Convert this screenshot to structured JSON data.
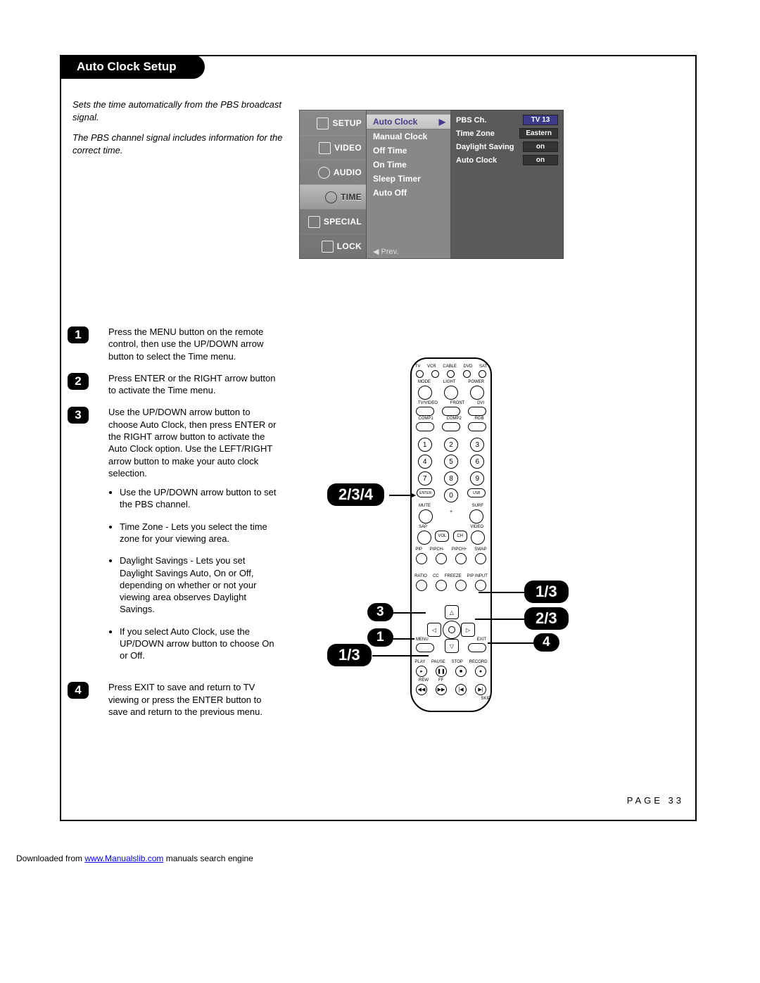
{
  "title": "Auto Clock Setup",
  "intro_p1": "Sets the time automatically from the PBS broadcast signal.",
  "intro_p2": "The PBS channel signal includes information for the correct time.",
  "osd": {
    "cats": {
      "setup": "SETUP",
      "video": "VIDEO",
      "audio": "AUDIO",
      "time": "TIME",
      "special": "SPECIAL",
      "lock": "LOCK"
    },
    "items": {
      "auto_clock": "Auto Clock",
      "manual_clock": "Manual Clock",
      "off_time": "Off Time",
      "on_time": "On Time",
      "sleep_timer": "Sleep Timer",
      "auto_off": "Auto Off"
    },
    "arrow": "▶",
    "prev": "◀ Prev.",
    "kv": {
      "pbs_k": "PBS Ch.",
      "pbs_v": "TV  13",
      "tz_k": "Time Zone",
      "tz_v": "Eastern",
      "ds_k": "Daylight Saving",
      "ds_v": "on",
      "ac_k": "Auto Clock",
      "ac_v": "on"
    }
  },
  "steps": {
    "s1": "Press the MENU button on the remote control, then use the UP/DOWN arrow button to select the Time menu.",
    "s2": "Press ENTER or the RIGHT arrow button to activate the Time menu.",
    "s3": "Use the UP/DOWN arrow button to choose Auto Clock, then press ENTER or the RIGHT arrow button to activate the Auto Clock option. Use the LEFT/RIGHT arrow button to make your auto clock selection.",
    "s3_b1": "Use the UP/DOWN arrow button to set the PBS channel.",
    "s3_b2": "Time Zone - Lets you select the time zone for your viewing area.",
    "s3_b3": "Daylight Savings - Lets you set Daylight Savings Auto, On or Off, depending on whether or not your viewing area observes Daylight Savings.",
    "s3_b4": "If you select Auto Clock, use the UP/DOWN arrow button to choose On or Off.",
    "s4": "Press EXIT to save and return to TV viewing or press the ENTER button to save and return to the previous menu."
  },
  "remote_labels": {
    "top_row": [
      "TV",
      "VCR",
      "CABLE",
      "DVD",
      "SAT"
    ],
    "mode_row": [
      "MODE",
      "LIGHT",
      "POWER"
    ],
    "tvv_row": [
      "TV/VIDEO",
      "FRONT",
      "DVI"
    ],
    "comp_row": [
      "COMP1",
      "COMP2",
      "RGB"
    ],
    "nums": [
      "1",
      "2",
      "3",
      "4",
      "5",
      "6",
      "7",
      "8",
      "9",
      "0"
    ],
    "enter_usb": [
      "ENTER",
      "USB"
    ],
    "mute_surf": [
      "MUTE",
      "SURF"
    ],
    "sap_video": [
      "SAP",
      "VIDEO"
    ],
    "vol_ch": [
      "VOL",
      "CH"
    ],
    "pip_row": [
      "PIP",
      "PIPCH-",
      "PIPCH+",
      "SWAP"
    ],
    "ratio_row": [
      "RATIO",
      "CC",
      "FREEZE",
      "PIP INPUT"
    ],
    "menu_exit": [
      "MENU",
      "EXIT"
    ],
    "play_row": [
      "PLAY",
      "PAUSE",
      "STOP",
      "RECORD"
    ],
    "rew_row": [
      "REW",
      "FF"
    ],
    "skip": "SKIP",
    "dpad": {
      "up": "△",
      "down": "▽",
      "left": "◁",
      "right": "▷"
    }
  },
  "callouts": {
    "c234": "2/3/4",
    "c3": "3",
    "c1": "1",
    "c13a": "1/3",
    "c13b": "1/3",
    "c23": "2/3",
    "c4": "4"
  },
  "page_num": "PAGE 33",
  "footer_pre": "Downloaded from ",
  "footer_link": "www.Manualslib.com",
  "footer_post": " manuals search engine"
}
